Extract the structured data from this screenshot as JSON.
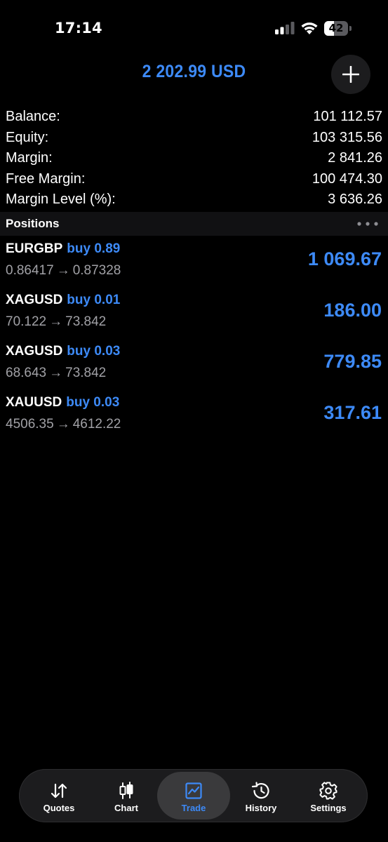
{
  "status_bar": {
    "time": "17:14",
    "battery_level": "42",
    "battery_fraction": 0.42
  },
  "header": {
    "title": "2 202.99 USD",
    "add_icon": "plus-icon"
  },
  "summary": [
    {
      "label": "Balance:",
      "value": "101 112.57"
    },
    {
      "label": "Equity:",
      "value": "103 315.56"
    },
    {
      "label": "Margin:",
      "value": "2 841.26"
    },
    {
      "label": "Free Margin:",
      "value": "100 474.30"
    },
    {
      "label": "Margin Level (%):",
      "value": "3 636.26"
    }
  ],
  "positions_section": {
    "title": "Positions",
    "more_icon": "more-horizontal-icon"
  },
  "positions": [
    {
      "symbol": "EURGBP",
      "direction": "buy 0.89",
      "open_price": "0.86417",
      "arrow": "→",
      "current_price": "0.87328",
      "profit": "1 069.67"
    },
    {
      "symbol": "XAGUSD",
      "direction": "buy 0.01",
      "open_price": "70.122",
      "arrow": "→",
      "current_price": "73.842",
      "profit": "186.00"
    },
    {
      "symbol": "XAGUSD",
      "direction": "buy 0.03",
      "open_price": "68.643",
      "arrow": "→",
      "current_price": "73.842",
      "profit": "779.85"
    },
    {
      "symbol": "XAUUSD",
      "direction": "buy 0.03",
      "open_price": "4506.35",
      "arrow": "→",
      "current_price": "4612.22",
      "profit": "317.61"
    }
  ],
  "tab_bar": {
    "active": "Trade",
    "tabs": [
      {
        "label": "Quotes",
        "icon": "sort-arrows-icon"
      },
      {
        "label": "Chart",
        "icon": "candlestick-icon"
      },
      {
        "label": "Trade",
        "icon": "trade-chart-icon"
      },
      {
        "label": "History",
        "icon": "history-clock-icon"
      },
      {
        "label": "Settings",
        "icon": "gear-icon"
      }
    ]
  },
  "colors": {
    "accent": "#3d8af7",
    "background": "#000000",
    "secondary_text": "#a1a1a6",
    "tab_bar_bg": "#1c1c1e",
    "active_tab_bg": "#3a3a3c"
  }
}
